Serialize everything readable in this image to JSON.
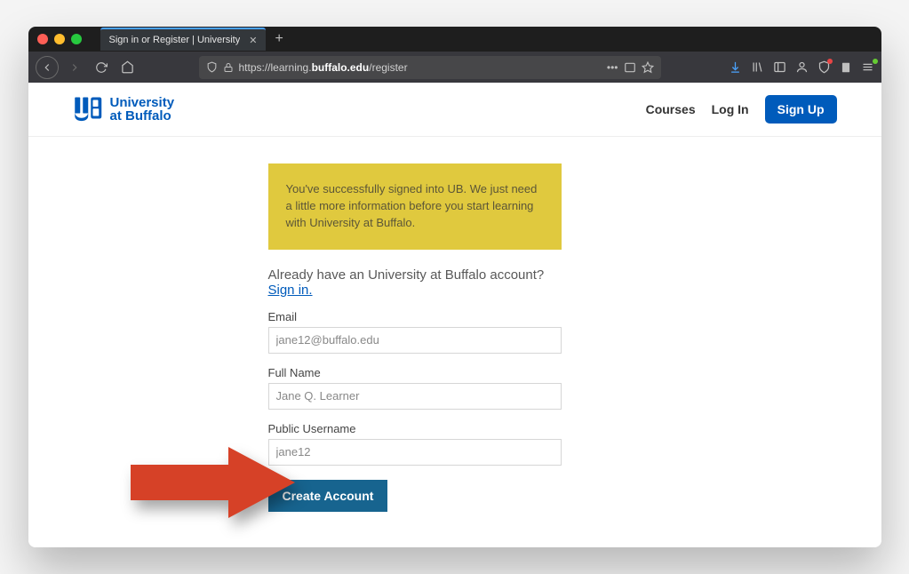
{
  "browser": {
    "tab_title": "Sign in or Register | University",
    "url_display": {
      "scheme": "https://learning.",
      "host": "buffalo.edu",
      "path": "/register"
    }
  },
  "logo": {
    "line1": "University",
    "line2": "at Buffalo"
  },
  "nav": {
    "courses": "Courses",
    "login": "Log In",
    "signup": "Sign Up"
  },
  "banner": "You've successfully signed into UB. We just need a little more information before you start learning with University at Buffalo.",
  "already": {
    "text": "Already have an University at Buffalo account? ",
    "link": "Sign in."
  },
  "fields": {
    "email_label": "Email",
    "email_value": "jane12@buffalo.edu",
    "name_label": "Full Name",
    "name_value": "Jane Q. Learner",
    "username_label": "Public Username",
    "username_value": "jane12"
  },
  "create_label": "Create Account"
}
